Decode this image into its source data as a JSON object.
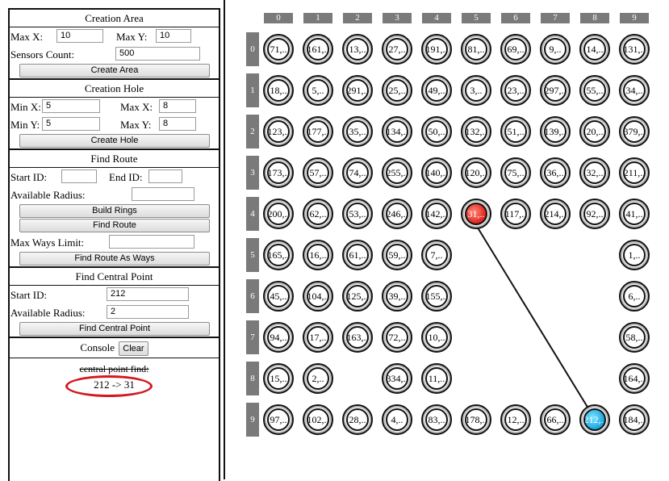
{
  "creation_area": {
    "title": "Creation Area",
    "max_x_label": "Max X:",
    "max_x_value": "10",
    "max_y_label": "Max Y:",
    "max_y_value": "10",
    "sensors_label": "Sensors Count:",
    "sensors_value": "500",
    "button": "Create Area"
  },
  "creation_hole": {
    "title": "Creation Hole",
    "min_x_label": "Min X:",
    "min_x_value": "5",
    "max_x_label": "Max X:",
    "max_x_value": "8",
    "min_y_label": "Min Y:",
    "min_y_value": "5",
    "max_y_label": "Max Y:",
    "max_y_value": "8",
    "button": "Create Hole"
  },
  "find_route": {
    "title": "Find Route",
    "start_label": "Start ID:",
    "start_value": "",
    "end_label": "End ID:",
    "end_value": "",
    "radius_label": "Available Radius:",
    "radius_value": "",
    "build_rings": "Build Rings",
    "find_route": "Find Route",
    "max_ways_label": "Max Ways Limit:",
    "max_ways_value": "",
    "find_ways": "Find Route As Ways"
  },
  "central_point": {
    "title": "Find Central Point",
    "start_label": "Start ID:",
    "start_value": "212",
    "radius_label": "Available Radius:",
    "radius_value": "2",
    "button": "Find Central Point"
  },
  "console": {
    "title": "Console",
    "clear": "Clear",
    "line1": "central point find:",
    "line2": "212 -> 31"
  },
  "grid": {
    "col_headers": [
      "0",
      "1",
      "2",
      "3",
      "4",
      "5",
      "6",
      "7",
      "8",
      "9"
    ],
    "row_headers": [
      "0",
      "1",
      "2",
      "3",
      "4",
      "5",
      "6",
      "7",
      "8",
      "9"
    ],
    "rows": [
      [
        "71,..",
        "161,..",
        "13,..",
        "27,..",
        "191,..",
        "81,..",
        "69,..",
        "9,..",
        "14,..",
        "131,.."
      ],
      [
        "18,..",
        "5,..",
        "291,..",
        "25,..",
        "49,..",
        "3,..",
        "23,..",
        "297,..",
        "55,..",
        "34,.."
      ],
      [
        "123,..",
        "177,..",
        "35,..",
        "134,..",
        "50,..",
        "132,..",
        "51,..",
        "139,..",
        "20,..",
        "379,.."
      ],
      [
        "173,..",
        "57,..",
        "74,..",
        "255,..",
        "140,..",
        "120,..",
        "75,..",
        "36,..",
        "32,..",
        "211,.."
      ],
      [
        "200,..",
        "62,..",
        "53,..",
        "246,..",
        "142,..",
        "31,..",
        "117,..",
        "214,..",
        "92,..",
        "41,.."
      ],
      [
        "165,..",
        "16,..",
        "61,..",
        "59,..",
        "7,..",
        null,
        null,
        null,
        null,
        "1,.."
      ],
      [
        "45,..",
        "104,..",
        "125,..",
        "39,..",
        "155,..",
        null,
        null,
        null,
        null,
        "6,.."
      ],
      [
        "94,..",
        "17,..",
        "163,..",
        "72,..",
        "10,..",
        null,
        null,
        null,
        null,
        "58,.."
      ],
      [
        "15,..",
        "2,..",
        null,
        "334,..",
        "11,..",
        null,
        null,
        null,
        null,
        "164,.."
      ],
      [
        "97,..",
        "102,..",
        "28,..",
        "4,..",
        "83,..",
        "178,..",
        "12,..",
        "66,..",
        "212,..",
        "184,.."
      ]
    ],
    "highlight_end": [
      4,
      5
    ],
    "highlight_start": [
      9,
      8
    ],
    "colors": {
      "end": "#e0221c",
      "start": "#1aa4de",
      "header": "#7a7a7a",
      "ellipse": "#d4181f"
    }
  }
}
